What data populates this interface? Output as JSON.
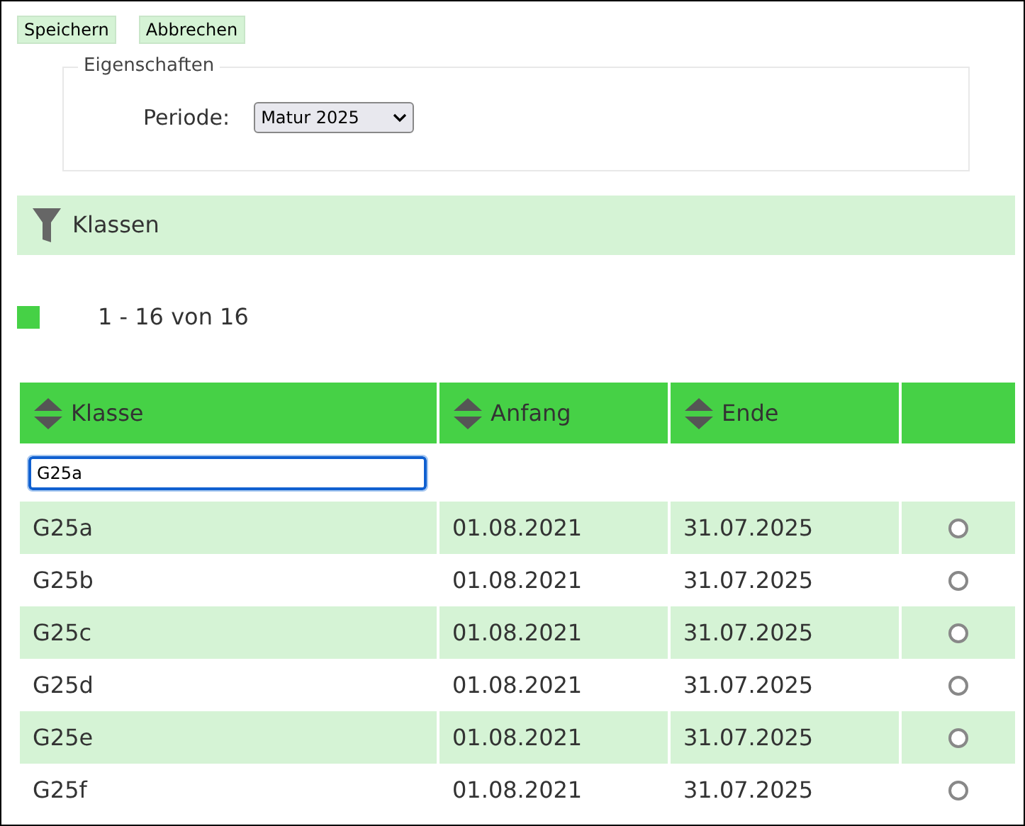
{
  "toolbar": {
    "buttons": [
      "Speichern",
      "Abbrechen"
    ]
  },
  "properties": {
    "legend": "Eigenschaften",
    "field_label": "Periode:",
    "select_value": "Matur 2025"
  },
  "filter_bar": {
    "title": "Klassen"
  },
  "pager": {
    "text": "1 - 16 von 16"
  },
  "table": {
    "columns": [
      {
        "label": "Klasse",
        "sortable": true
      },
      {
        "label": "Anfang",
        "sortable": true
      },
      {
        "label": "Ende",
        "sortable": true
      },
      {
        "sortable": false
      }
    ],
    "filter_value": "G25a",
    "rows": [
      {
        "cells": [
          "G25a",
          "01.08.2021",
          "31.07.2025"
        ],
        "selected": false
      },
      {
        "cells": [
          "G25b",
          "01.08.2021",
          "31.07.2025"
        ],
        "selected": false
      },
      {
        "cells": [
          "G25c",
          "01.08.2021",
          "31.07.2025"
        ],
        "selected": false
      },
      {
        "cells": [
          "G25d",
          "01.08.2021",
          "31.07.2025"
        ],
        "selected": false
      },
      {
        "cells": [
          "G25e",
          "01.08.2021",
          "31.07.2025"
        ],
        "selected": false
      },
      {
        "cells": [
          "G25f",
          "01.08.2021",
          "31.07.2025"
        ],
        "selected": false
      }
    ]
  }
}
